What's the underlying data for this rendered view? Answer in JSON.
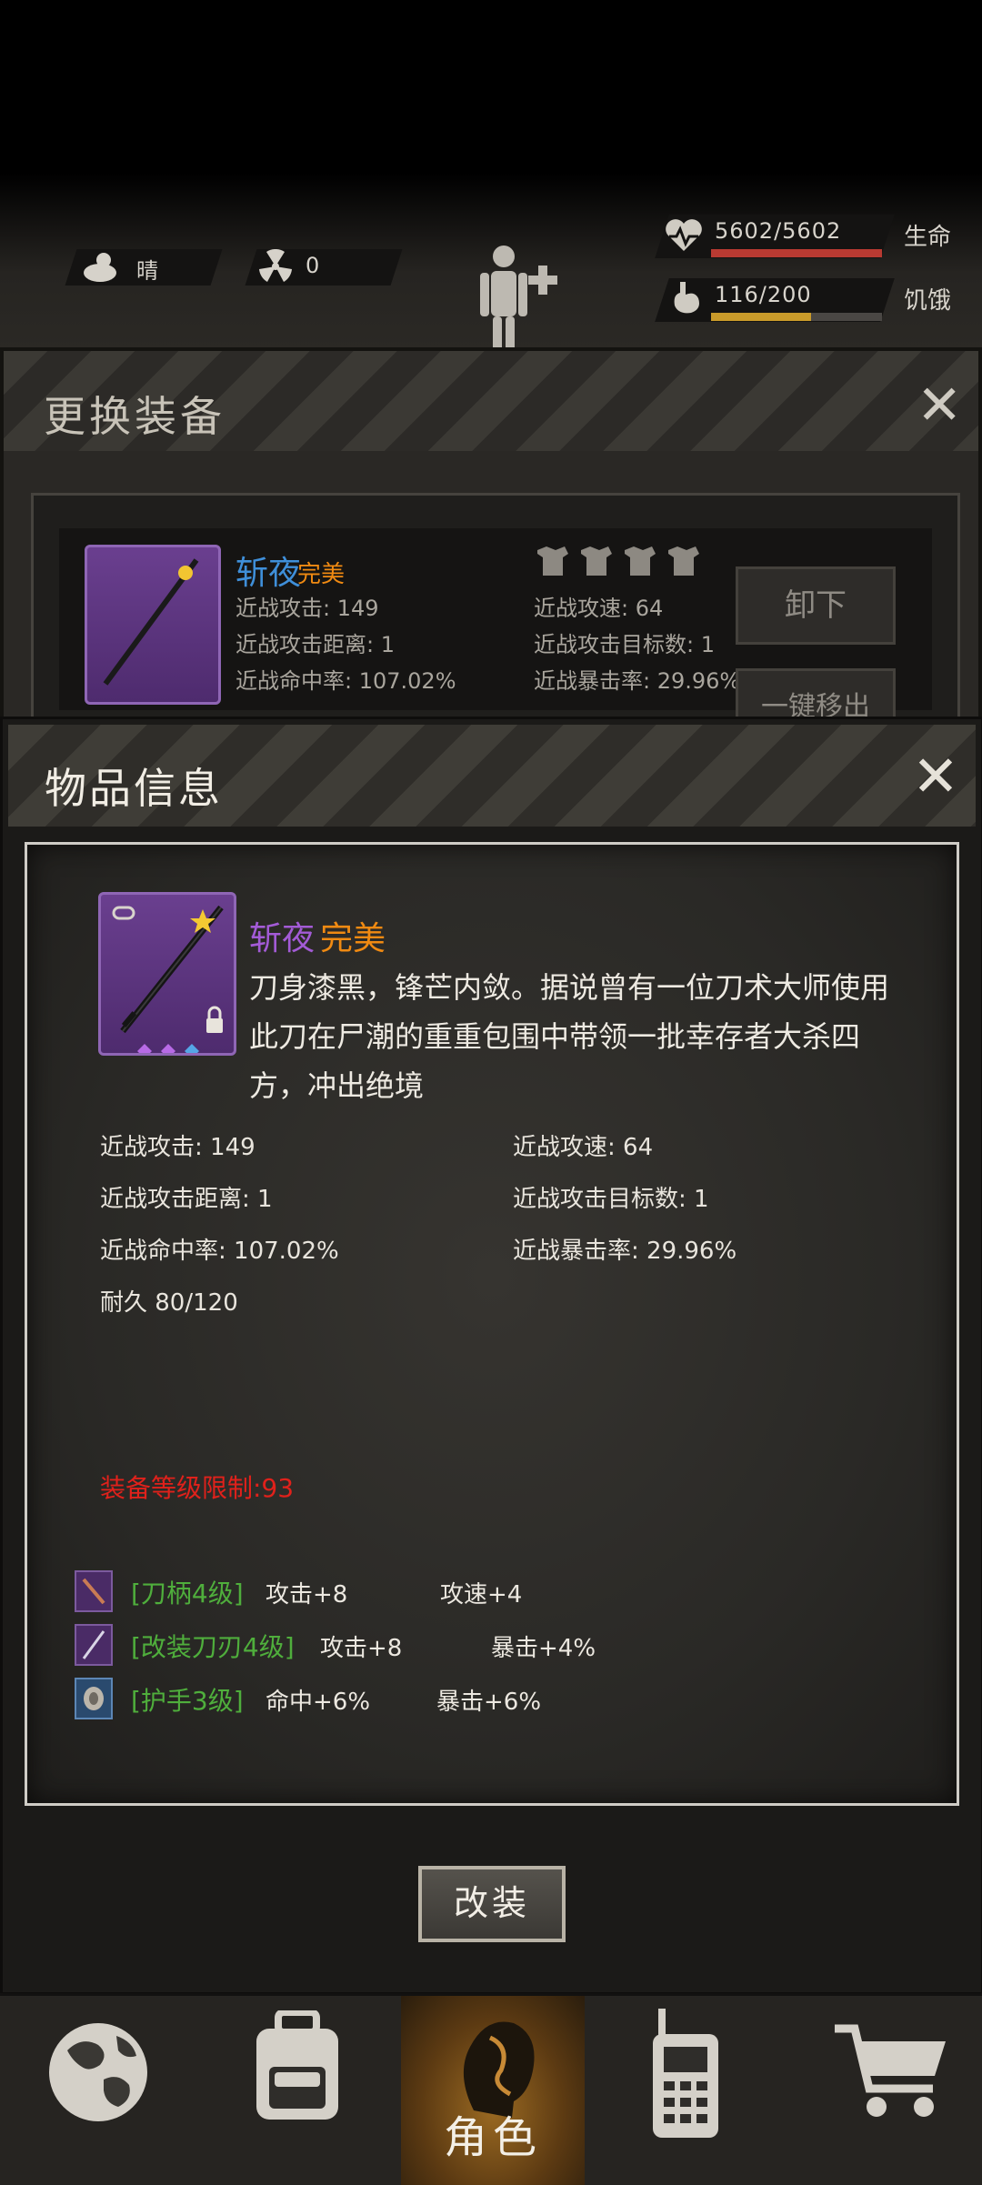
{
  "status": {
    "weather": "晴",
    "radiation": "0",
    "hp": "5602/5602",
    "hp_label": "生命",
    "hp_fraction": 1.0,
    "hunger": "116/200",
    "hunger_label": "饥饿",
    "hunger_fraction": 0.58
  },
  "equip_panel": {
    "title": "更换装备",
    "item_name": "斩夜",
    "item_quality": "完美",
    "stats": [
      "近战攻击: 149",
      "近战攻速: 64",
      "近战攻击距离: 1",
      "近战攻击目标数: 1",
      "近战命中率: 107.02%",
      "近战暴击率: 29.96%"
    ],
    "unequip_label": "卸下",
    "move_out_label": "一键移出",
    "tiers": [
      "Ⅰ",
      "Ⅱ",
      "Ⅲ",
      "Ⅳ"
    ]
  },
  "item_info": {
    "title": "物品信息",
    "name": "斩夜",
    "quality": "完美",
    "description": "刀身漆黑，锋芒内敛。据说曾有一位刀术大师使用此刀在尸潮的重重包围中带领一批幸存者大杀四方，冲出绝境",
    "stats": {
      "attack": "近战攻击: 149",
      "speed": "近战攻速: 64",
      "range": "近战攻击距离: 1",
      "targets": "近战攻击目标数: 1",
      "hit": "近战命中率: 107.02%",
      "crit": "近战暴击率: 29.96%",
      "durability": "耐久 80/120"
    },
    "level_requirement": "装备等级限制:93",
    "mods": [
      {
        "name": "[刀柄4级]",
        "stat1": "攻击+8",
        "stat2": "攻速+4"
      },
      {
        "name": "[改装刀刃4级]",
        "stat1": "攻击+8",
        "stat2": "暴击+4%"
      },
      {
        "name": "[护手3级]",
        "stat1": "命中+6%",
        "stat2": "暴击+6%"
      }
    ],
    "modify_button": "改装"
  },
  "nav": {
    "items": [
      "world",
      "backpack",
      "character",
      "radio",
      "shop"
    ],
    "active": "character",
    "character_label": "角色"
  },
  "colors": {
    "accent_purple": "#a35bd6",
    "quality_orange": "#f08a12",
    "mod_green": "#4fae3c",
    "requirement_red": "#e0211b"
  }
}
